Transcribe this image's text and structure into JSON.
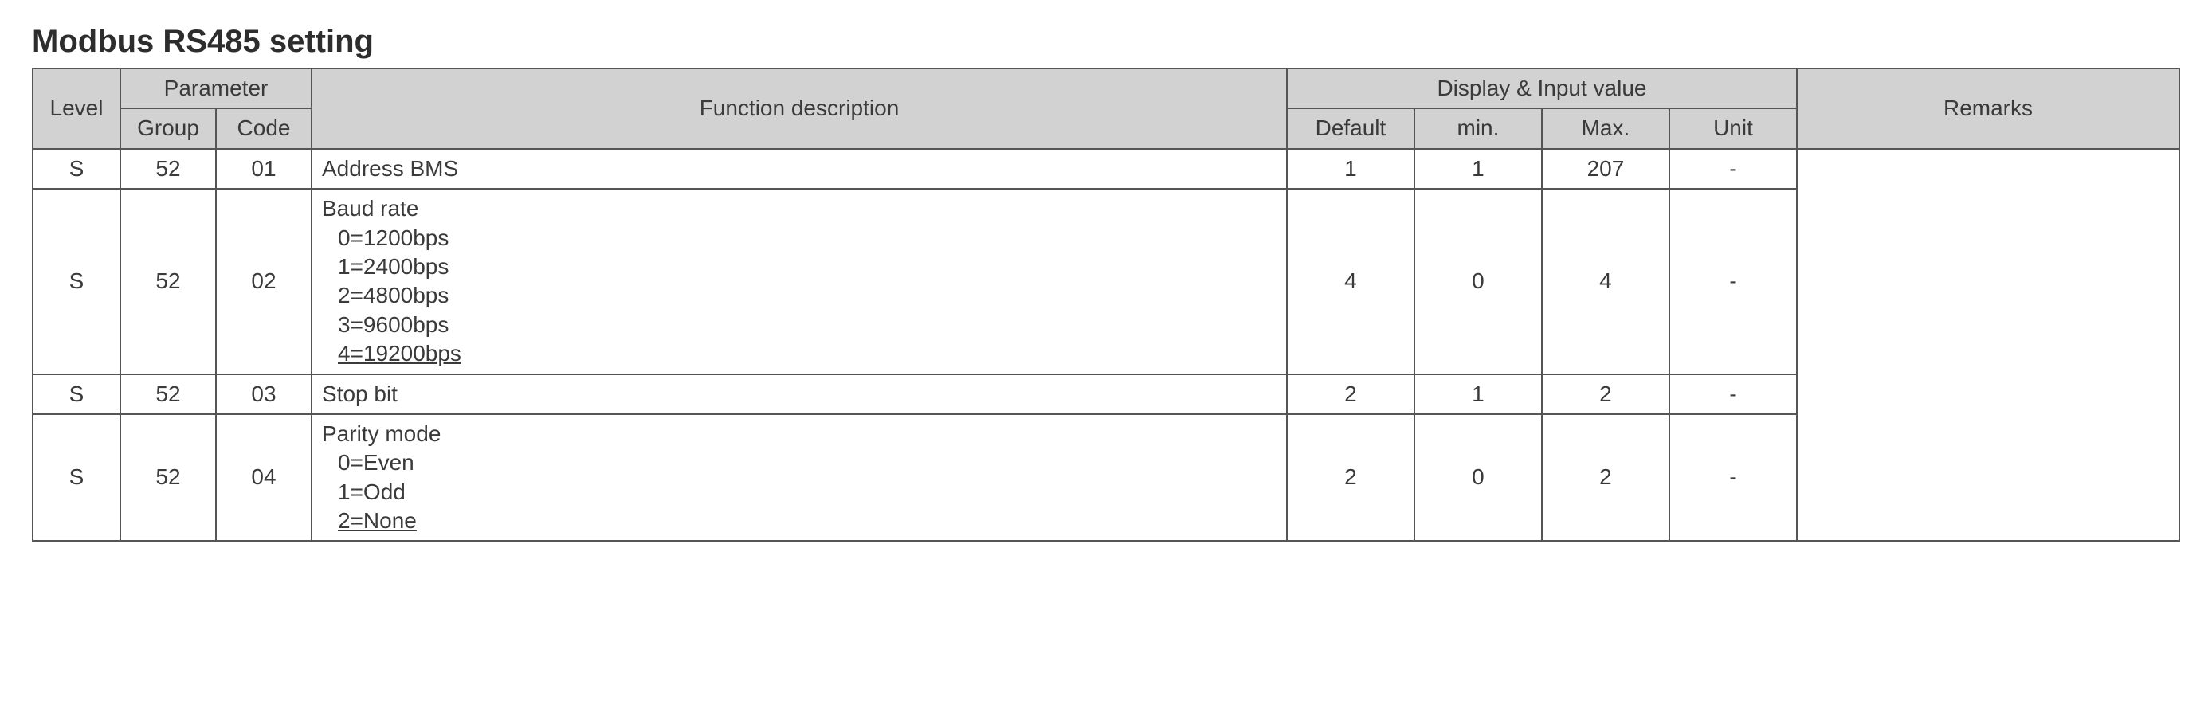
{
  "title": "Modbus RS485 setting",
  "headers": {
    "level": "Level",
    "parameter": "Parameter",
    "group": "Group",
    "code": "Code",
    "function": "Function description",
    "display_input": "Display & Input value",
    "default": "Default",
    "min": "min.",
    "max": "Max.",
    "unit": "Unit",
    "remarks": "Remarks"
  },
  "rows": [
    {
      "level": "S",
      "group": "52",
      "code": "01",
      "func_title": "Address BMS",
      "func_options": [],
      "default": "1",
      "min": "1",
      "max": "207",
      "unit": "-",
      "remarks": ""
    },
    {
      "level": "S",
      "group": "52",
      "code": "02",
      "func_title": "Baud rate",
      "func_options": [
        {
          "text": "0=1200bps",
          "underline": false
        },
        {
          "text": "1=2400bps",
          "underline": false
        },
        {
          "text": "2=4800bps",
          "underline": false
        },
        {
          "text": "3=9600bps",
          "underline": false
        },
        {
          "text": "4=19200bps",
          "underline": true
        }
      ],
      "default": "4",
      "min": "0",
      "max": "4",
      "unit": "-",
      "remarks": ""
    },
    {
      "level": "S",
      "group": "52",
      "code": "03",
      "func_title": "Stop bit",
      "func_options": [],
      "default": "2",
      "min": "1",
      "max": "2",
      "unit": "-",
      "remarks": ""
    },
    {
      "level": "S",
      "group": "52",
      "code": "04",
      "func_title": "Parity mode",
      "func_options": [
        {
          "text": "0=Even",
          "underline": false
        },
        {
          "text": "1=Odd",
          "underline": false
        },
        {
          "text": "2=None",
          "underline": true
        }
      ],
      "default": "2",
      "min": "0",
      "max": "2",
      "unit": "-",
      "remarks": ""
    }
  ]
}
